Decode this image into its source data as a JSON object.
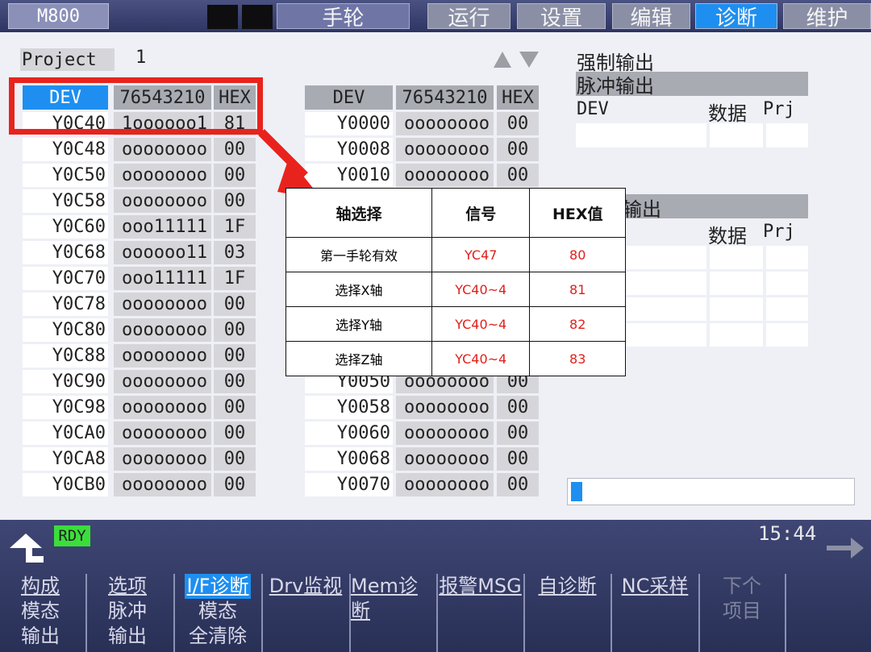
{
  "header": {
    "model": "M800",
    "mode": "手轮",
    "tabs": [
      {
        "label": "运行",
        "active": false
      },
      {
        "label": "设置",
        "active": false
      },
      {
        "label": "编辑",
        "active": false
      },
      {
        "label": "诊断",
        "active": true
      },
      {
        "label": "维护",
        "active": false
      }
    ]
  },
  "project": {
    "label": "Project",
    "value": "1"
  },
  "left_table": {
    "headers": [
      "DEV",
      "76543210",
      "HEX"
    ],
    "rows": [
      [
        "Y0C40",
        "1oooooo1",
        "81"
      ],
      [
        "Y0C48",
        "oooooooo",
        "00"
      ],
      [
        "Y0C50",
        "oooooooo",
        "00"
      ],
      [
        "Y0C58",
        "oooooooo",
        "00"
      ],
      [
        "Y0C60",
        "ooo11111",
        "1F"
      ],
      [
        "Y0C68",
        "oooooo11",
        "03"
      ],
      [
        "Y0C70",
        "ooo11111",
        "1F"
      ],
      [
        "Y0C78",
        "oooooooo",
        "00"
      ],
      [
        "Y0C80",
        "oooooooo",
        "00"
      ],
      [
        "Y0C88",
        "oooooooo",
        "00"
      ],
      [
        "Y0C90",
        "oooooooo",
        "00"
      ],
      [
        "Y0C98",
        "oooooooo",
        "00"
      ],
      [
        "Y0CA0",
        "oooooooo",
        "00"
      ],
      [
        "Y0CA8",
        "oooooooo",
        "00"
      ],
      [
        "Y0CB0",
        "oooooooo",
        "00"
      ]
    ]
  },
  "right_table": {
    "headers": [
      "DEV",
      "76543210",
      "HEX"
    ],
    "rows": [
      [
        "Y0000",
        "oooooooo",
        "00"
      ],
      [
        "Y0008",
        "oooooooo",
        "00"
      ],
      [
        "Y0010",
        "oooooooo",
        "00"
      ],
      [
        "Y0050",
        "oooooooo",
        "00"
      ],
      [
        "Y0058",
        "oooooooo",
        "00"
      ],
      [
        "Y0060",
        "oooooooo",
        "00"
      ],
      [
        "Y0068",
        "oooooooo",
        "00"
      ],
      [
        "Y0070",
        "oooooooo",
        "00"
      ]
    ]
  },
  "forced_output": {
    "title1": "强制输出",
    "title2": "脉冲输出",
    "col_dev": "DEV",
    "col_data": "数据",
    "col_prj": "Prj",
    "title3": "输出",
    "col_data2": "数据",
    "col_prj2": "Prj"
  },
  "callout": {
    "headers": [
      "轴选择",
      "信号",
      "HEX值"
    ],
    "rows": [
      [
        "第一手轮有效",
        "YC47",
        "80"
      ],
      [
        "选择X轴",
        "YC40~4",
        "81"
      ],
      [
        "选择Y轴",
        "YC40~4",
        "82"
      ],
      [
        "选择Z轴",
        "YC40~4",
        "83"
      ]
    ],
    "accent": "#e8231d"
  },
  "status": {
    "rdy": "RDY",
    "time": "15:44"
  },
  "function_keys": [
    {
      "lines": [
        "构成",
        "模态",
        "输出"
      ],
      "active": false
    },
    {
      "lines": [
        "选项",
        "脉冲",
        "输出"
      ],
      "active": false
    },
    {
      "lines": [
        "I/F诊断",
        "模态",
        "全清除"
      ],
      "active": true
    },
    {
      "lines": [
        "Drv监视"
      ],
      "active": false
    },
    {
      "lines": [
        "Mem诊断"
      ],
      "active": false
    },
    {
      "lines": [
        "报警MSG"
      ],
      "active": false
    },
    {
      "lines": [
        "自诊断"
      ],
      "active": false
    },
    {
      "lines": [
        "NC采样"
      ],
      "active": false
    },
    {
      "lines": [
        "",
        "下个",
        "项目"
      ],
      "active": false
    },
    {
      "lines": [
        ""
      ],
      "active": false
    }
  ],
  "colors": {
    "accent_blue": "#1e8ff0",
    "rdy_green": "#3ade3a",
    "callout_red": "#e8231d"
  }
}
